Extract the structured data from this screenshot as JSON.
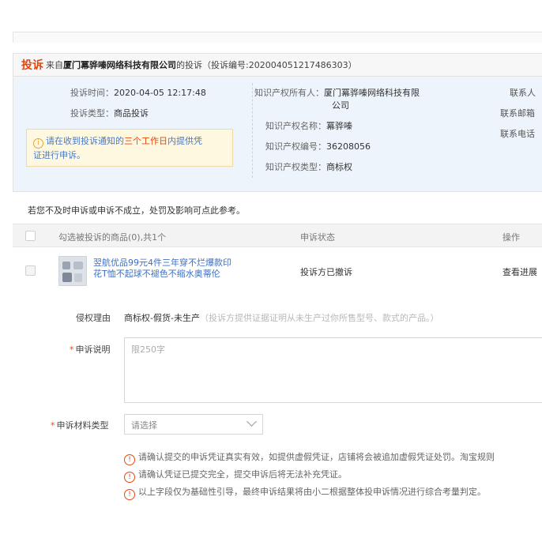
{
  "header": {
    "tousu_word": "投诉",
    "from_prefix": "来自",
    "company": "厦门冪骅嗪网络科技有限公司",
    "suffix": "的投诉（投诉编号:202004051217486303）"
  },
  "info": {
    "time_label": "投诉时间：",
    "time_value": "2020-04-05 12:17:48",
    "type_label": "投诉类型：",
    "type_value": "商品投诉",
    "notice_prefix": "请在收到投诉通知的",
    "notice_highlight": "三个工作日",
    "notice_suffix_line1": "内提供凭",
    "notice_line2": "证进行申诉。",
    "owner_label": "知识产权所有人：",
    "owner_value_line1": "厦门冪骅嗪网络科技有限",
    "owner_value_line2": "公司",
    "ip_name_label": "知识产权名称：",
    "ip_name_value": "冪骅嗪",
    "ip_no_label": "知识产权编号：",
    "ip_no_value": "36208056",
    "ip_type_label": "知识产权类型：",
    "ip_type_value": "商标权",
    "contact_label": "联系人",
    "email_label": "联系邮箱",
    "phone_label": "联系电话"
  },
  "consequence_text": "若您不及时申诉或申诉不成立，处罚及影响可点此参考。",
  "table": {
    "col_goods": "勾选被投诉的商品(0),共1个",
    "col_status": "申诉状态",
    "col_action": "操作",
    "rows": [
      {
        "name_line1": "翌航优品99元4件三年穿不烂爆款印",
        "name_line2": "花T恤不起球不褪色不缩水奥蒂伦",
        "status": "投诉方已撤诉",
        "action": "查看进展"
      }
    ]
  },
  "form": {
    "reason_label": "侵权理由",
    "reason_value": "商标权-假货-未生产",
    "reason_hint": "（投诉方提供证据证明从未生产过你所售型号、款式的产品。）",
    "desc_label": "申诉说明",
    "desc_placeholder": "限250字",
    "material_label": "申诉材料类型",
    "material_placeholder": "请选择",
    "tips": [
      "请确认提交的申诉凭证真实有效，如提供虚假凭证，店铺将会被追加虚假凭证处罚。淘宝规则",
      "请确认凭证已提交完全，提交申诉后将无法补充凭证。",
      "以上字段仅为基础性引导，最终申诉结果将由小二根据整体投申诉情况进行综合考量判定。"
    ]
  },
  "colors": {
    "accent_red": "#e4470f",
    "link_blue": "#3d6fc4",
    "panel_bg": "#eef4fb"
  },
  "icons": [
    "warning-circle-icon",
    "chevron-down-icon",
    "product-thumbnail"
  ]
}
